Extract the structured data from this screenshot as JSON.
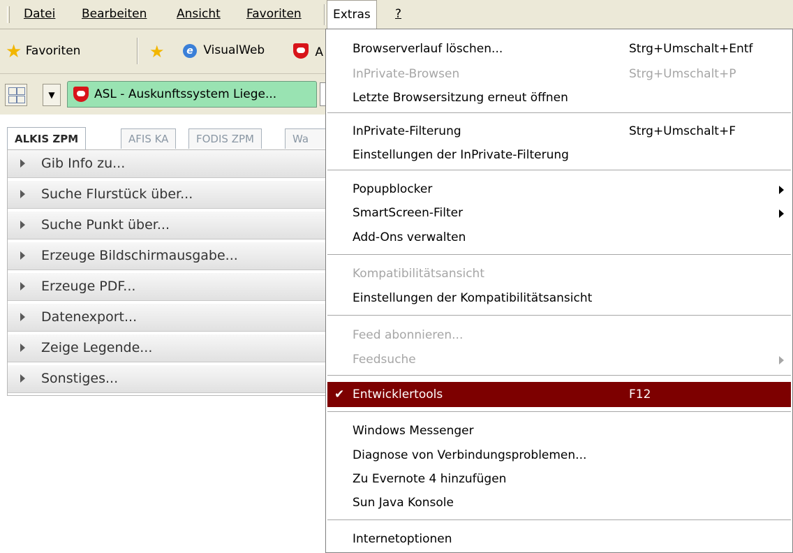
{
  "menubar": {
    "items": [
      {
        "label": "Datei"
      },
      {
        "label": "Bearbeiten"
      },
      {
        "label": "Ansicht"
      },
      {
        "label": "Favoriten"
      },
      {
        "label": "Extras"
      },
      {
        "label": "?"
      }
    ]
  },
  "favbar": {
    "favorites_label": "Favoriten",
    "visualweb_label": "VisualWeb",
    "cut_label": "A"
  },
  "tabbar": {
    "active_tab_title": "ASL - Auskunftssystem Liege..."
  },
  "app": {
    "tabs": [
      {
        "label": "ALKIS ZPM"
      },
      {
        "label": "AFIS KA"
      },
      {
        "label": "FODIS ZPM"
      },
      {
        "label": "Wa"
      }
    ],
    "accordion": [
      {
        "label": "Gib Info zu..."
      },
      {
        "label": "Suche Flurstück über..."
      },
      {
        "label": "Suche Punkt über..."
      },
      {
        "label": "Erzeuge Bildschirmausgabe..."
      },
      {
        "label": "Erzeuge PDF..."
      },
      {
        "label": "Datenexport..."
      },
      {
        "label": "Zeige Legende..."
      },
      {
        "label": "Sonstiges..."
      }
    ]
  },
  "dropdown": {
    "items": [
      {
        "label": "Browserverlauf löschen...",
        "shortcut": "Strg+Umschalt+Entf"
      },
      {
        "label": "InPrivate-Browsen",
        "shortcut": "Strg+Umschalt+P"
      },
      {
        "label": "Letzte Browsersitzung erneut öffnen",
        "shortcut": ""
      },
      {
        "label": "InPrivate-Filterung",
        "shortcut": "Strg+Umschalt+F"
      },
      {
        "label": "Einstellungen der InPrivate-Filterung",
        "shortcut": ""
      },
      {
        "label": "Popupblocker",
        "shortcut": ""
      },
      {
        "label": "SmartScreen-Filter",
        "shortcut": ""
      },
      {
        "label": "Add-Ons verwalten",
        "shortcut": ""
      },
      {
        "label": "Kompatibilitätsansicht",
        "shortcut": ""
      },
      {
        "label": "Einstellungen der Kompatibilitätsansicht",
        "shortcut": ""
      },
      {
        "label": "Feed abonnieren...",
        "shortcut": ""
      },
      {
        "label": "Feedsuche",
        "shortcut": ""
      },
      {
        "label": "Entwicklertools",
        "shortcut": "F12",
        "checkmark": "✔"
      },
      {
        "label": "Windows Messenger",
        "shortcut": ""
      },
      {
        "label": "Diagnose von Verbindungsproblemen...",
        "shortcut": ""
      },
      {
        "label": "Zu Evernote 4 hinzufügen",
        "shortcut": ""
      },
      {
        "label": "Sun Java Konsole",
        "shortcut": ""
      },
      {
        "label": "Internetoptionen",
        "shortcut": ""
      }
    ],
    "highlight_color": "#7d0000"
  }
}
